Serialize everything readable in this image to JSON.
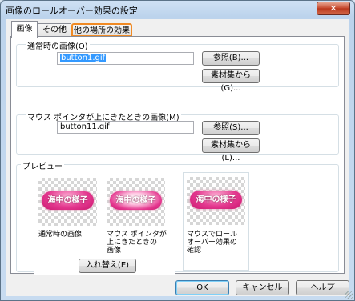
{
  "window": {
    "title": "画像のロールオーバー効果の設定",
    "close_symbol": "✕"
  },
  "tabs": [
    {
      "label": "画像"
    },
    {
      "label": "その他"
    },
    {
      "label": "他の場所の効果"
    }
  ],
  "normal_image": {
    "label": "通常時の画像(O)",
    "value": "button1.gif",
    "browse_label": "参照(B)...",
    "library_label": "素材集から(G)..."
  },
  "hover_image": {
    "label": "マウス ポインタが上にきたときの画像(M)",
    "value": "button11.gif",
    "browse_label": "参照(S)...",
    "library_label": "素材集から(L)..."
  },
  "preview": {
    "label": "プレビュー",
    "button_text": "海中の様子",
    "caption_normal": "通常時の画像",
    "caption_hover": "マウス ポインタが\n上にきたときの\n画像",
    "caption_check": "マウスでロール\nオーバー効果の\n確認",
    "swap_label": "入れ替え(E)"
  },
  "footer": {
    "ok_label": "OK",
    "cancel_label": "キャンセル",
    "help_label": "ヘルプ"
  }
}
